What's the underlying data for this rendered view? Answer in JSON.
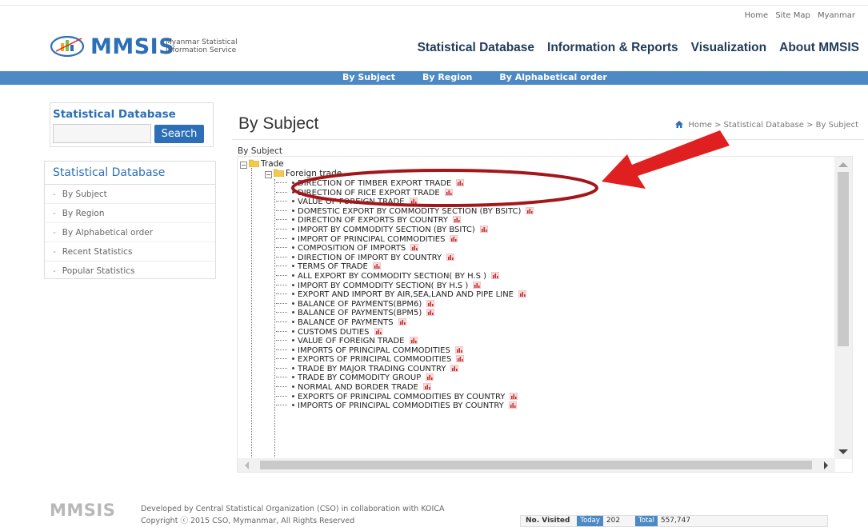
{
  "utility": [
    "Home",
    "Site Map",
    "Myanmar"
  ],
  "header": {
    "brand": "MMSIS",
    "brand_sub_1": "Myanmar Statistical",
    "brand_sub_2": "Information Service",
    "nav": [
      "Statistical Database",
      "Information & Reports",
      "Visualization",
      "About MMSIS"
    ]
  },
  "subnav": [
    "By Subject",
    "By Region",
    "By Alphabetical order"
  ],
  "sidebar": {
    "search_title": "Statistical Database",
    "search_value": "",
    "search_button": "Search",
    "menu_title": "Statistical Database",
    "menu_items": [
      "By Subject",
      "By Region",
      "By Alphabetical order",
      "Recent Statistics",
      "Popular Statistics"
    ]
  },
  "content": {
    "title": "By Subject",
    "breadcrumb": "Home > Statistical Database > By Subject",
    "tree_label": "By Subject",
    "root_node": "Trade",
    "sub_node": "Foreign trade",
    "items": [
      "DIRECTION OF TIMBER EXPORT TRADE",
      "DIRECTION OF RICE EXPORT TRADE",
      "VALUE OF FOREIGN TRADE",
      "DOMESTIC EXPORT BY COMMODITY SECTION (BY BSITC)",
      "DIRECTION OF EXPORTS BY COUNTRY",
      "IMPORT BY COMMODITY SECTION (BY BSITC)",
      "IMPORT OF PRINCIPAL COMMODITIES",
      "COMPOSITION OF IMPORTS",
      "DIRECTION OF IMPORT BY COUNTRY",
      "TERMS OF TRADE",
      "ALL EXPORT BY COMMODITY SECTION( BY H.S )",
      "IMPORT BY COMMODITY SECTION( BY H.S )",
      "EXPORT AND IMPORT BY AIR,SEA,LAND AND PIPE LINE",
      "BALANCE OF PAYMENTS(BPM6)",
      "BALANCE OF PAYMENTS(BPM5)",
      "BALANCE OF PAYMENTS",
      "CUSTOMS DUTIES",
      "VALUE OF FOREIGN TRADE",
      "IMPORTS OF PRINCIPAL COMMODITIES",
      "EXPORTS OF PRINCIPAL COMMODITIES",
      "TRADE BY MAJOR TRADING COUNTRY",
      "TRADE BY COMMODITY GROUP",
      "NORMAL AND BORDER TRADE",
      "EXPORTS OF PRINCIPAL COMMODITIES BY COUNTRY",
      "IMPORTS OF PRINCIPAL COMMODITIES BY COUNTRY"
    ]
  },
  "footer": {
    "logo": "MMSIS",
    "line1": "Developed by Central Statistical Organization (CSO) in collaboration with KOICA",
    "line2": "Copyright ⓒ 2015 CSO, Mymanmar, All Rights Reserved",
    "visited_label": "No. Visited",
    "today_label": "Today",
    "today_count": "202",
    "total_label": "Total",
    "total_count": "557,747"
  },
  "colors": {
    "brand_blue": "#2d6fb7",
    "subnav_blue": "#4d89c5",
    "annotation_red": "#e02020",
    "ellipse_red": "#a3171a"
  }
}
